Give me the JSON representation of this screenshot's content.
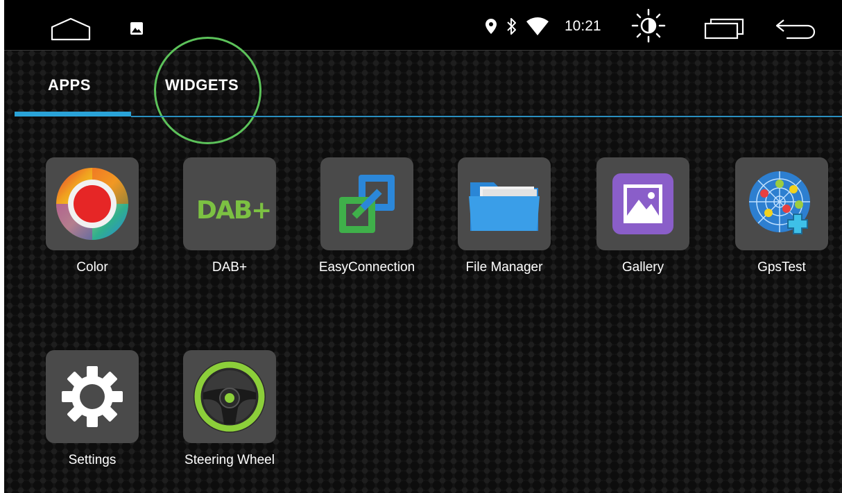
{
  "status_bar": {
    "time": "10:21",
    "icons": [
      "home-icon",
      "image-notification-icon",
      "location-icon",
      "bluetooth-icon",
      "wifi-icon",
      "brightness-icon",
      "recent-apps-icon",
      "back-icon"
    ]
  },
  "tabs": [
    {
      "label": "APPS",
      "selected": true
    },
    {
      "label": "WIDGETS",
      "selected": false
    }
  ],
  "apps": [
    {
      "label": "Color",
      "icon": "color-wheel-icon"
    },
    {
      "label": "DAB+",
      "icon": "dab-plus-icon"
    },
    {
      "label": "EasyConnection",
      "icon": "easy-connection-icon"
    },
    {
      "label": "File Manager",
      "icon": "folder-icon"
    },
    {
      "label": "Gallery",
      "icon": "gallery-icon"
    },
    {
      "label": "GpsTest",
      "icon": "gps-radar-icon"
    },
    {
      "label": "Settings",
      "icon": "gear-icon"
    },
    {
      "label": "Steering Wheel",
      "icon": "steering-wheel-icon"
    }
  ],
  "dab_logo_text": "DAB+",
  "colors": {
    "tab_indicator": "#2aa3d8",
    "highlight_circle": "#5cc25a",
    "background": "#141414"
  }
}
